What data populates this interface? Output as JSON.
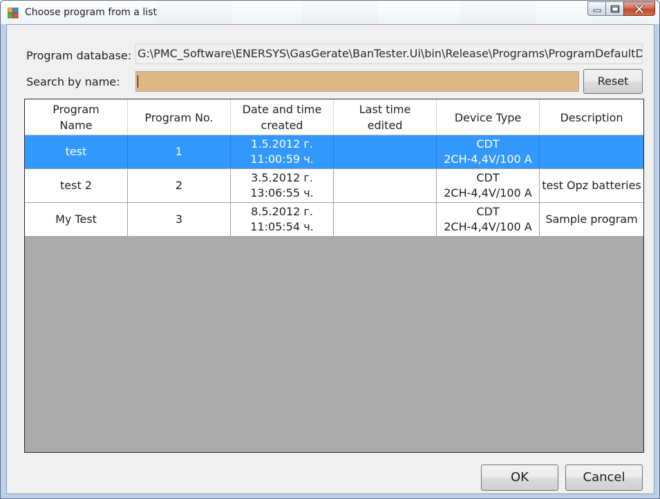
{
  "window": {
    "title": "Choose program from a list"
  },
  "form": {
    "db_label": "Program database:",
    "db_path": "G:\\PMC_Software\\ENERSYS\\GasGerate\\BanTester.Ui\\bin\\Release\\Programs\\ProgramDefaultDatal",
    "search_label": "Search by name:",
    "search_value": "",
    "reset_label": "Reset",
    "search_bg_color": "#deb887"
  },
  "grid": {
    "columns": [
      {
        "line1": "Program",
        "line2": "Name"
      },
      {
        "line1": "Program No.",
        "line2": ""
      },
      {
        "line1": "Date and time",
        "line2": "created"
      },
      {
        "line1": "Last time",
        "line2": "edited"
      },
      {
        "line1": "Device Type",
        "line2": ""
      },
      {
        "line1": "Description",
        "line2": ""
      }
    ],
    "rows": [
      {
        "name": "test",
        "number": "1",
        "created_date": "1.5.2012 г.",
        "created_time": "11:00:59 ч.",
        "edited": "",
        "device_line1": "CDT",
        "device_line2": "2CH-4,4V/100 A",
        "description": ""
      },
      {
        "name": "test 2",
        "number": "2",
        "created_date": "3.5.2012 г.",
        "created_time": "13:06:55 ч.",
        "edited": "",
        "device_line1": "CDT",
        "device_line2": "2CH-4,4V/100 A",
        "description": "test Opz batteries"
      },
      {
        "name": "My Test",
        "number": "3",
        "created_date": "8.5.2012 г.",
        "created_time": "11:05:54 ч.",
        "edited": "",
        "device_line1": "CDT",
        "device_line2": "2CH-4,4V/100 A",
        "description": "Sample program"
      }
    ],
    "selected_row_color": "#3399ff"
  },
  "footer": {
    "ok_label": "OK",
    "cancel_label": "Cancel"
  },
  "icons": {
    "app": "app-icon",
    "minimize": "minimize-icon",
    "maximize": "maximize-icon",
    "close": "close-icon"
  }
}
